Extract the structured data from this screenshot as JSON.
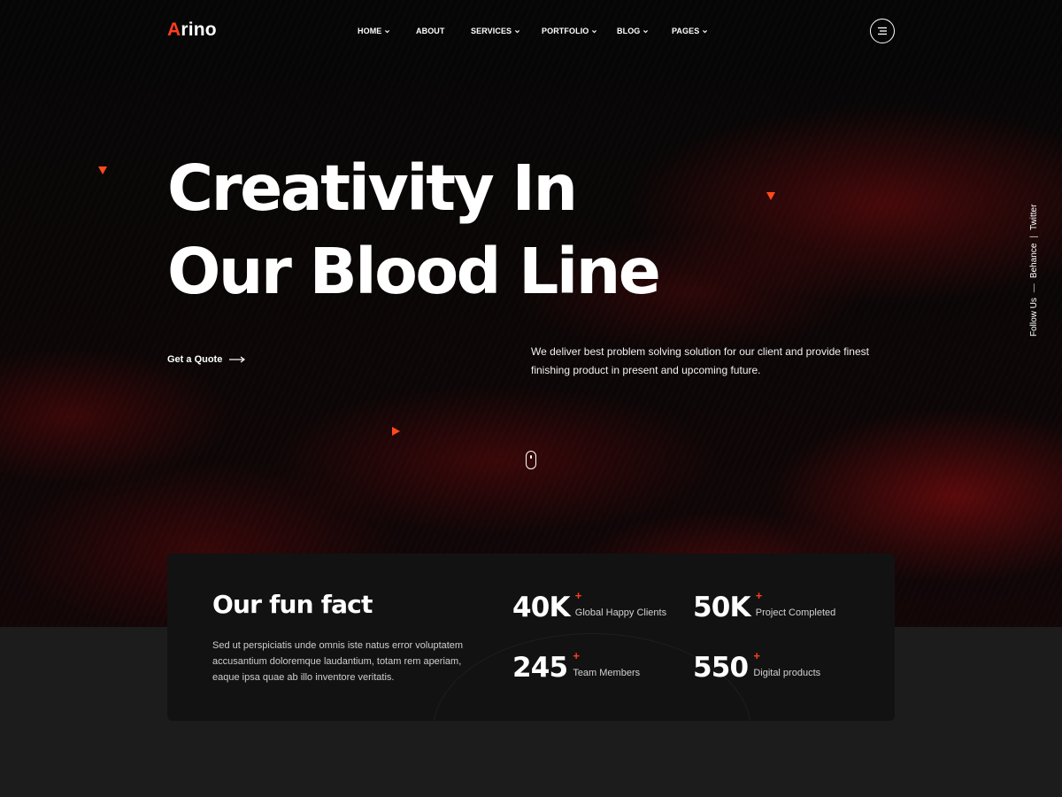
{
  "brand": {
    "logo_accent": "A",
    "logo_rest": "rino",
    "accent_color": "#ff3d1f"
  },
  "nav": {
    "items": [
      {
        "label": "HOME",
        "dropdown": true
      },
      {
        "label": "ABOUT",
        "dropdown": false
      },
      {
        "label": "SERVICES",
        "dropdown": true
      },
      {
        "label": "PORTFOLIO",
        "dropdown": true
      },
      {
        "label": "BLOG",
        "dropdown": true
      },
      {
        "label": "PAGES",
        "dropdown": true
      }
    ],
    "menu_icon": "hamburger-icon"
  },
  "hero": {
    "title_line1": "Creativity In",
    "title_line2": "Our Blood Line",
    "cta_label": "Get a Quote",
    "description": "We deliver best problem solving solution for our client and provide finest finishing product in present and upcoming future.",
    "scroll_icon": "mouse-icon"
  },
  "social": {
    "label": "Follow Us",
    "links": [
      "Behance",
      "Twitter"
    ]
  },
  "fun_fact": {
    "title": "Our fun fact",
    "text": "Sed ut perspiciatis unde omnis iste natus error voluptatem accusantium doloremque laudantium, totam rem aperiam, eaque ipsa quae ab illo inventore veritatis.",
    "stats": [
      {
        "value": "40K",
        "plus": "+",
        "label": "Global Happy Clients"
      },
      {
        "value": "50K",
        "plus": "+",
        "label": "Project Completed"
      },
      {
        "value": "245",
        "plus": "+",
        "label": "Team Members"
      },
      {
        "value": "550",
        "plus": "+",
        "label": "Digital products"
      }
    ]
  }
}
